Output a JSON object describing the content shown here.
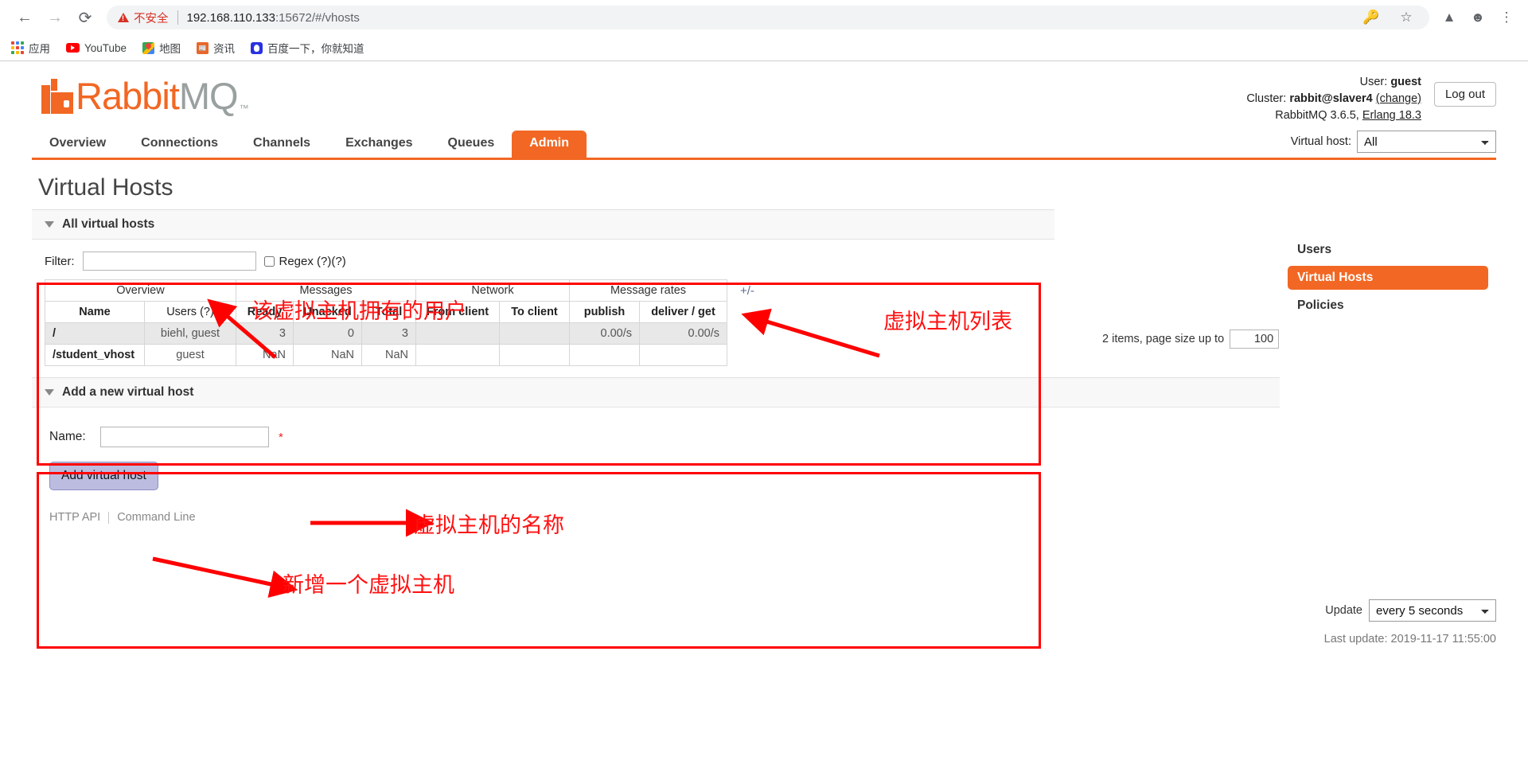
{
  "browser": {
    "back_icon": "back-arrow-icon",
    "forward_icon": "forward-arrow-icon",
    "reload_icon": "reload-icon",
    "security_label": "不安全",
    "url_host": "192.168.110.133",
    "url_path": ":15672/#/vhosts",
    "bookmarks": [
      {
        "label": "应用",
        "icon": "apps-grid-icon"
      },
      {
        "label": "YouTube",
        "icon": "youtube-icon"
      },
      {
        "label": "地图",
        "icon": "maps-icon"
      },
      {
        "label": "资讯",
        "icon": "news-icon"
      },
      {
        "label": "百度一下，你就知道",
        "icon": "baidu-icon"
      }
    ]
  },
  "header": {
    "logo_rabbit": "Rabbit",
    "logo_mq": "MQ",
    "logo_tm": "™",
    "user_label": "User:",
    "user_name": "guest",
    "cluster_label": "Cluster:",
    "cluster_name": "rabbit@slaver4",
    "cluster_change": "(change)",
    "version_text": "RabbitMQ 3.6.5,",
    "erlang_text": "Erlang 18.3",
    "logout_label": "Log out"
  },
  "nav": {
    "tabs": [
      {
        "label": "Overview",
        "active": false
      },
      {
        "label": "Connections",
        "active": false
      },
      {
        "label": "Channels",
        "active": false
      },
      {
        "label": "Exchanges",
        "active": false
      },
      {
        "label": "Queues",
        "active": false
      },
      {
        "label": "Admin",
        "active": true
      }
    ],
    "vhost_label": "Virtual host:",
    "vhost_value": "All"
  },
  "page": {
    "title": "Virtual Hosts"
  },
  "all_vhosts": {
    "section_title": "All virtual hosts",
    "filter_label": "Filter:",
    "filter_value": "",
    "regex_label": "Regex (?)(?)",
    "items_text": "2 items, page size up to",
    "page_size": "100",
    "plus_minus": "+/-",
    "group_headers": [
      {
        "label": "Overview",
        "span": 2
      },
      {
        "label": "Messages",
        "span": 3
      },
      {
        "label": "Network",
        "span": 2
      },
      {
        "label": "Message rates",
        "span": 2
      }
    ],
    "columns": [
      "Name",
      "Users (?)",
      "Ready",
      "Unacked",
      "Total",
      "From client",
      "To client",
      "publish",
      "deliver / get"
    ],
    "rows": [
      {
        "name": "/",
        "users": "biehl, guest",
        "ready": "3",
        "unacked": "0",
        "total": "3",
        "from_client": "",
        "to_client": "",
        "publish": "0.00/s",
        "deliver_get": "0.00/s"
      },
      {
        "name": "/student_vhost",
        "users": "guest",
        "ready": "NaN",
        "unacked": "NaN",
        "total": "NaN",
        "from_client": "",
        "to_client": "",
        "publish": "",
        "deliver_get": ""
      }
    ]
  },
  "add_vhost": {
    "section_title": "Add a new virtual host",
    "name_label": "Name:",
    "name_value": "",
    "required_mark": "*",
    "submit_label": "Add virtual host"
  },
  "footer": {
    "http_api": "HTTP API",
    "command_line": "Command Line"
  },
  "sidebar": {
    "items": [
      {
        "label": "Users",
        "active": false
      },
      {
        "label": "Virtual Hosts",
        "active": true
      },
      {
        "label": "Policies",
        "active": false
      }
    ]
  },
  "update": {
    "label": "Update",
    "value": "every 5 seconds",
    "last_update": "Last update: 2019-11-17 11:55:00"
  },
  "annotations": [
    {
      "text": "该虚拟主机拥有的用户",
      "name": "annotation-users-column"
    },
    {
      "text": "虚拟主机列表",
      "name": "annotation-vhost-list"
    },
    {
      "text": "虚拟主机的名称",
      "name": "annotation-vhost-name"
    },
    {
      "text": "新增一个虚拟主机",
      "name": "annotation-add-vhost"
    }
  ],
  "colors": {
    "brand_orange": "#f26723",
    "annotation_red": "#ff0000",
    "button_lavender": "#bcbce0"
  }
}
